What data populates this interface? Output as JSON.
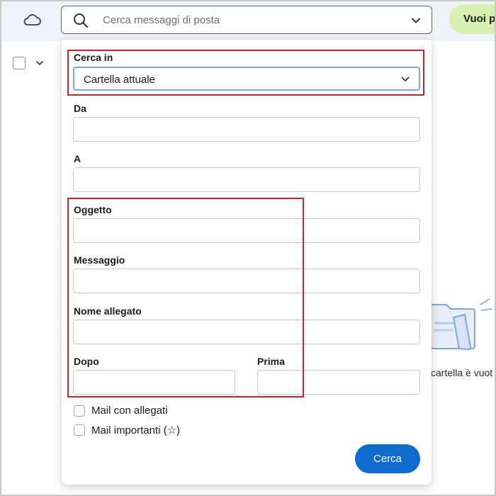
{
  "topbar": {
    "cloud_icon": "cloud-icon",
    "search": {
      "placeholder": "Cerca messaggi di posta",
      "icon": "search-icon",
      "dropdown_icon": "chevron-down-icon"
    },
    "promo_label": "Vuoi p"
  },
  "panel": {
    "cerca_in": {
      "label": "Cerca in",
      "value": "Cartella attuale"
    },
    "da": {
      "label": "Da",
      "value": ""
    },
    "a": {
      "label": "A",
      "value": ""
    },
    "oggetto": {
      "label": "Oggetto",
      "value": ""
    },
    "messaggio": {
      "label": "Messaggio",
      "value": ""
    },
    "nome_allegato": {
      "label": "Nome allegato",
      "value": ""
    },
    "dopo": {
      "label": "Dopo",
      "value": ""
    },
    "prima": {
      "label": "Prima",
      "value": ""
    },
    "checkboxes": [
      {
        "label": "Mail con allegati",
        "checked": false
      },
      {
        "label": "Mail importanti (☆)",
        "checked": false
      }
    ],
    "search_button": "Cerca"
  },
  "empty_state": {
    "text": "cartella è vuot"
  },
  "colors": {
    "accent": "#0f6cce",
    "topbar_bg": "#eef2f9",
    "promo_bg": "#d8f0b0",
    "highlight": "#c1272d"
  }
}
